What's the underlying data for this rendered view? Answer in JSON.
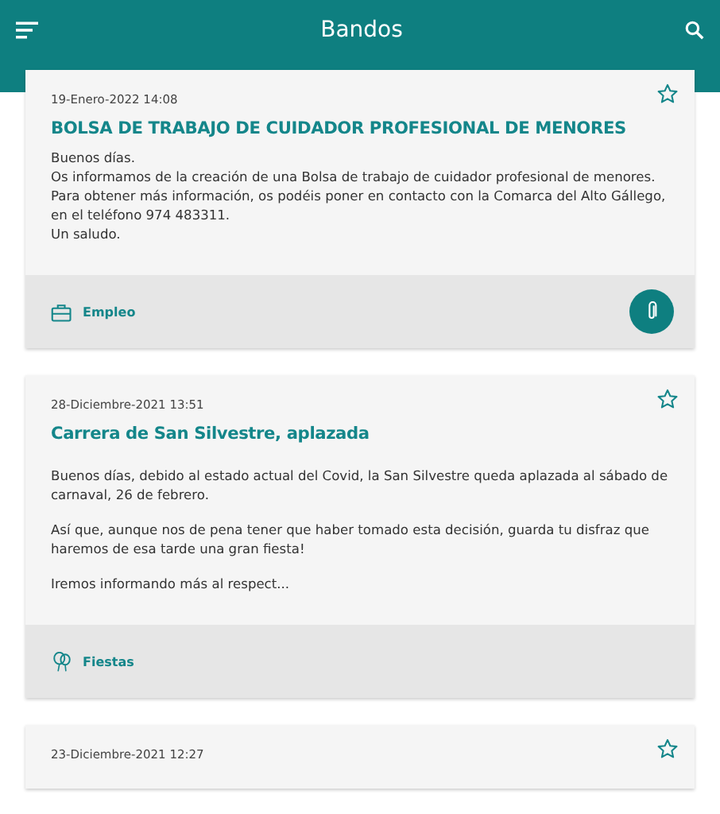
{
  "app_bar": {
    "title": "Bandos"
  },
  "notices": [
    {
      "date": "19-Enero-2022 14:08",
      "title": "BOLSA DE TRABAJO DE CUIDADOR PROFESIONAL DE MENORES",
      "paragraphs": [
        "Buenos días.\nOs informamos de la creación de una Bolsa de trabajo de cuidador profesional de menores.\nPara obtener más información, os podéis poner en contacto con la Comarca del Alto Gállego, en el teléfono 974 483311.\nUn saludo."
      ],
      "starred": false,
      "category": {
        "kind": "employment",
        "label": "Empleo"
      },
      "has_attachment": true
    },
    {
      "date": "28-Diciembre-2021 13:51",
      "title": "Carrera de San Silvestre, aplazada",
      "paragraphs": [
        "Buenos días, debido al estado actual del Covid, la San Silvestre queda aplazada al sábado de carnaval, 26 de febrero.",
        "Así que, aunque nos de pena tener que haber tomado esta decisión, guarda tu disfraz que haremos de esa tarde una gran fiesta!",
        "Iremos informando más al respect..."
      ],
      "starred": false,
      "category": {
        "kind": "party",
        "label": "Fiestas"
      },
      "has_attachment": false
    },
    {
      "date": "23-Diciembre-2021 12:27",
      "starred": false
    }
  ]
}
